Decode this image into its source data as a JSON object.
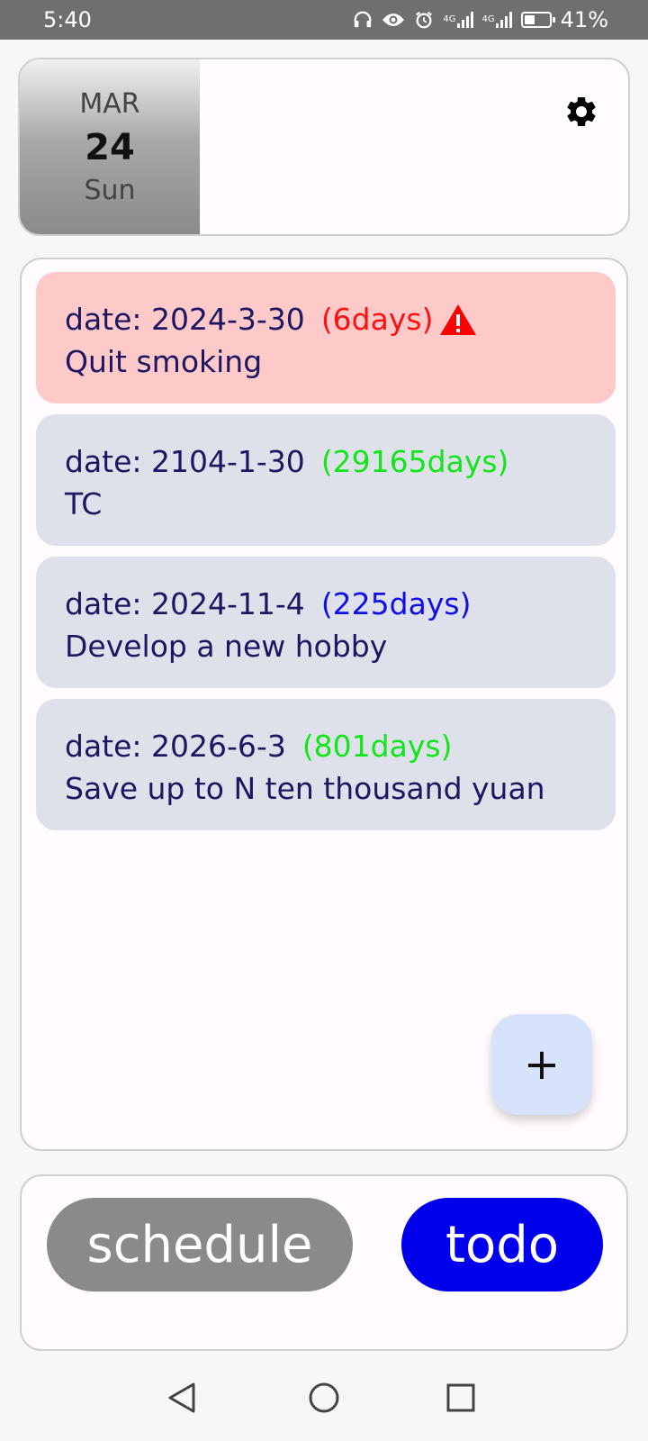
{
  "status_bar": {
    "time": "5:40",
    "network_1": "4G",
    "network_2": "4G",
    "battery": "41%",
    "battery_level": 0.41
  },
  "header": {
    "month": "MAR",
    "day": "24",
    "weekday": "Sun",
    "settings_icon": "gear-icon"
  },
  "todos": [
    {
      "date": "date: 2024-3-30",
      "days": "(6days)",
      "title": "Quit smoking",
      "days_color": "#ff1010",
      "highlight": true,
      "warning_icon": "warning-icon"
    },
    {
      "date": "date: 2104-1-30",
      "days": "(29165days)",
      "title": "TC",
      "days_color": "#12e61a",
      "highlight": false
    },
    {
      "date": "date: 2024-11-4",
      "days": "(225days)",
      "title": "Develop a new hobby",
      "days_color": "#1010e6",
      "highlight": false
    },
    {
      "date": "date: 2026-6-3",
      "days": "(801days)",
      "title": "Save up to N ten thousand yuan",
      "days_color": "#12e61a",
      "highlight": false
    }
  ],
  "fab": {
    "label": "+"
  },
  "tabs": [
    {
      "label": "schedule",
      "color": "#8a8a8a"
    },
    {
      "label": "todo",
      "color": "#0000ea"
    }
  ],
  "nav": {
    "back_icon": "back-icon",
    "home_icon": "home-icon",
    "recents_icon": "recents-icon"
  }
}
